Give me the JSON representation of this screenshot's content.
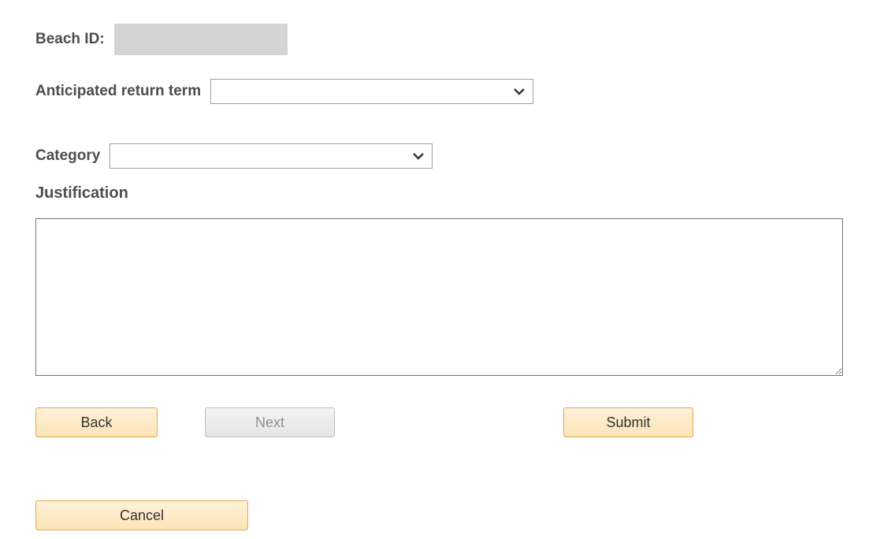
{
  "form": {
    "beach_id_label": "Beach ID:",
    "beach_id_value": "",
    "anticipated_return_label": "Anticipated return term",
    "anticipated_return_value": "",
    "category_label": "Category",
    "category_value": "",
    "justification_label": "Justification",
    "justification_value": ""
  },
  "buttons": {
    "back": "Back",
    "next": "Next",
    "submit": "Submit",
    "cancel": "Cancel"
  }
}
